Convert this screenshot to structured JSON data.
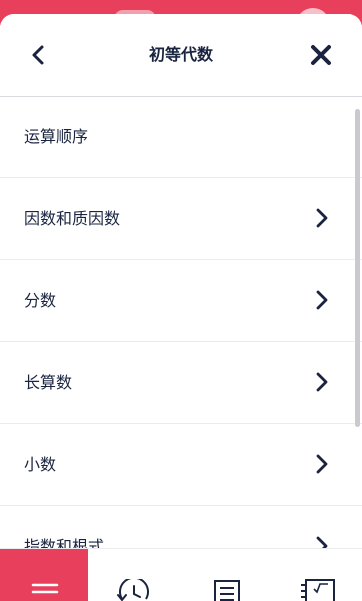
{
  "header": {
    "title": "初等代数",
    "back_icon": "chevron-left-icon",
    "close_icon": "close-x-icon"
  },
  "topics": [
    {
      "label": "运算顺序",
      "has_chevron": false
    },
    {
      "label": "因数和质因数",
      "has_chevron": true
    },
    {
      "label": "分数",
      "has_chevron": true
    },
    {
      "label": "长算数",
      "has_chevron": true
    },
    {
      "label": "小数",
      "has_chevron": true
    },
    {
      "label": "指数和根式",
      "has_chevron": true
    }
  ],
  "tabbar": {
    "active_tab": "menu",
    "tabs": [
      {
        "id": "menu",
        "icon": "menu-icon"
      },
      {
        "id": "history",
        "icon": "history-clock-icon"
      },
      {
        "id": "list",
        "icon": "list-document-icon"
      },
      {
        "id": "solver",
        "icon": "root-notepad-icon"
      }
    ]
  },
  "colors": {
    "accent": "#e8405c",
    "text": "#1a2440",
    "divider": "#ececf0"
  }
}
